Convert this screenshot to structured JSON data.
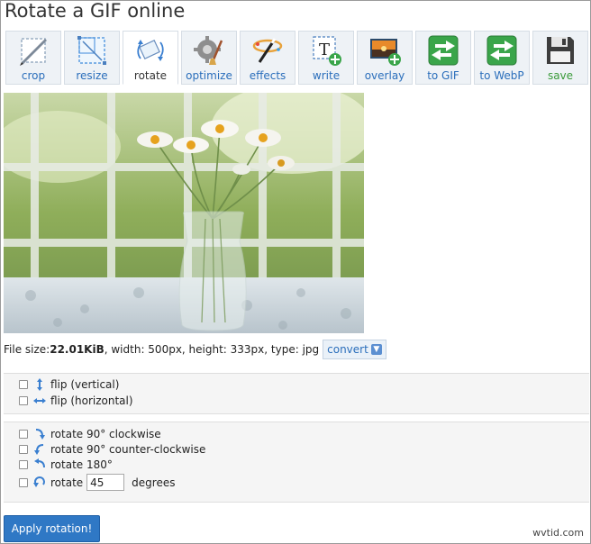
{
  "page": {
    "title": "Rotate a GIF online"
  },
  "toolbar": {
    "tools": [
      {
        "label": "crop",
        "icon": "crop-icon",
        "active": false
      },
      {
        "label": "resize",
        "icon": "resize-icon",
        "active": false
      },
      {
        "label": "rotate",
        "icon": "rotate-icon",
        "active": true
      },
      {
        "label": "optimize",
        "icon": "optimize-icon",
        "active": false
      },
      {
        "label": "effects",
        "icon": "effects-icon",
        "active": false
      },
      {
        "label": "write",
        "icon": "write-icon",
        "active": false
      },
      {
        "label": "overlay",
        "icon": "overlay-icon",
        "active": false
      },
      {
        "label": "to GIF",
        "icon": "to-gif-icon",
        "active": false
      },
      {
        "label": "to WebP",
        "icon": "to-webp-icon",
        "active": false
      },
      {
        "label": "save",
        "icon": "save-icon",
        "active": false
      }
    ]
  },
  "image": {
    "alt_icon": "photo-daisies-in-vase"
  },
  "fileinfo": {
    "prefix": "File size: ",
    "size": "22.01KiB",
    "rest": ", width: 500px, height: 333px, type: jpg",
    "convert_label": "convert"
  },
  "flip": {
    "vertical": "flip (vertical)",
    "horizontal": "flip (horizontal)"
  },
  "rotate": {
    "cw": "rotate 90° clockwise",
    "ccw": "rotate 90° counter-clockwise",
    "r180": "rotate 180°",
    "custom_prefix": "rotate",
    "custom_value": "45",
    "custom_suffix": "degrees"
  },
  "apply_label": "Apply rotation!",
  "watermark": "wvtid.com",
  "colors": {
    "accent": "#2f78c5",
    "link": "#2a6ebb",
    "panel": "#f5f5f5"
  }
}
